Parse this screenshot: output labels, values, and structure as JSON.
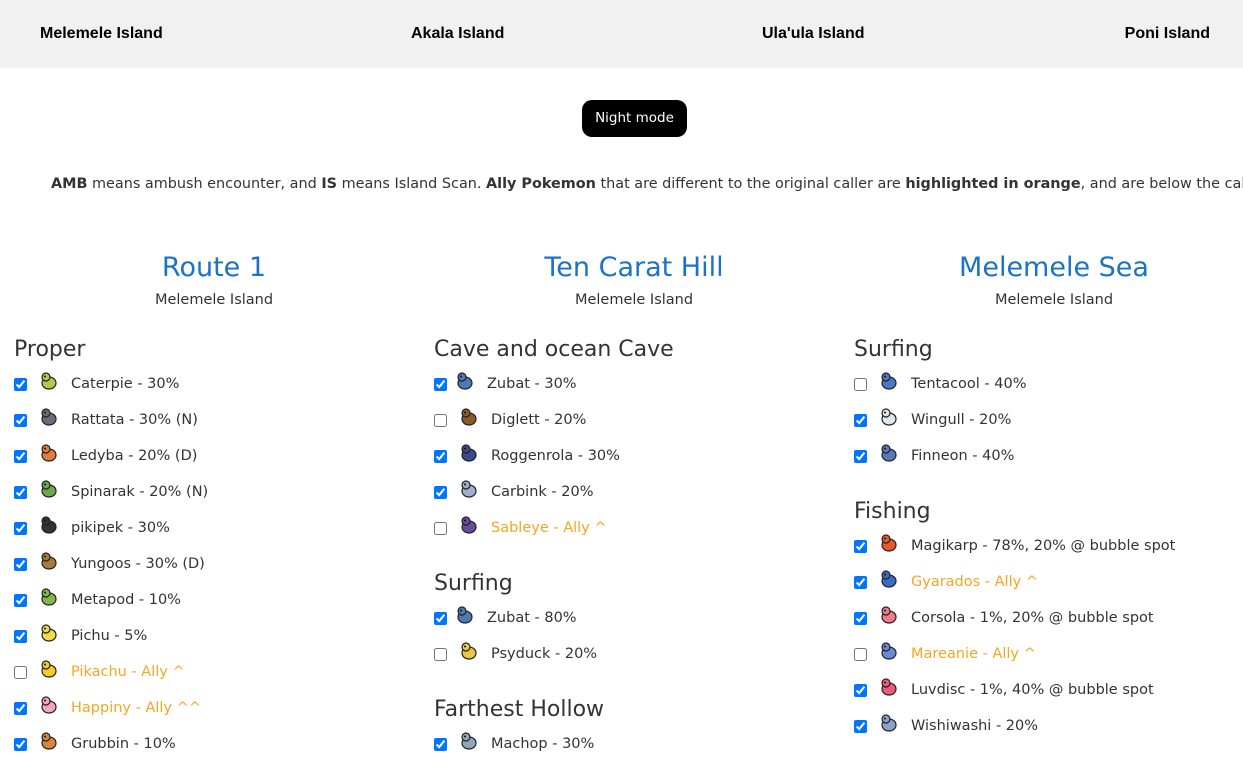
{
  "nav": [
    "Melemele Island",
    "Akala Island",
    "Ula'ula Island",
    "Poni Island"
  ],
  "night_mode_label": "Night mode",
  "info": {
    "amb": "AMB",
    "t1": " means ambush encounter, and ",
    "is": "IS",
    "t2": " means Island Scan. ",
    "ally": "Ally Pokemon",
    "t3": " that are different to the original caller are ",
    "hl": "highlighted in orange",
    "t4": ", and are below the caller."
  },
  "columns": [
    {
      "title": "Route 1",
      "island": "Melemele Island",
      "sections": [
        {
          "title": "Proper",
          "rows": [
            {
              "label": "Caterpie - 30%",
              "checked": true,
              "ally": false,
              "icon": "caterpie-icon",
              "color": "#b5c84a"
            },
            {
              "label": "Rattata - 30% (N)",
              "checked": true,
              "ally": false,
              "icon": "rattata-icon",
              "color": "#6b6b7a"
            },
            {
              "label": "Ledyba - 20% (D)",
              "checked": true,
              "ally": false,
              "icon": "ledyba-icon",
              "color": "#e0803a"
            },
            {
              "label": "Spinarak - 20% (N)",
              "checked": true,
              "ally": false,
              "icon": "spinarak-icon",
              "color": "#6aa84f"
            },
            {
              "label": "pikipek - 30%",
              "checked": true,
              "ally": false,
              "icon": "pikipek-icon",
              "color": "#333333"
            },
            {
              "label": "Yungoos - 30% (D)",
              "checked": true,
              "ally": false,
              "icon": "yungoos-icon",
              "color": "#a97a3c"
            },
            {
              "label": "Metapod - 10%",
              "checked": true,
              "ally": false,
              "icon": "metapod-icon",
              "color": "#7fb94a"
            },
            {
              "label": "Pichu - 5%",
              "checked": true,
              "ally": false,
              "icon": "pichu-icon",
              "color": "#f2d84c"
            },
            {
              "label": "Pikachu - Ally ^",
              "checked": false,
              "ally": true,
              "icon": "pikachu-icon",
              "color": "#f5cc2a"
            },
            {
              "label": "Happiny - Ally ^^",
              "checked": true,
              "ally": true,
              "icon": "happiny-icon",
              "color": "#f4a6b8"
            },
            {
              "label": "Grubbin - 10%",
              "checked": true,
              "ally": false,
              "icon": "grubbin-icon",
              "color": "#d9863a"
            }
          ]
        }
      ]
    },
    {
      "title": "Ten Carat Hill",
      "island": "Melemele Island",
      "sections": [
        {
          "title": "Cave and ocean Cave",
          "rows": [
            {
              "label": "Zubat - 30%",
              "checked": true,
              "ally": false,
              "icon": "zubat-icon",
              "color": "#4a7bb5",
              "tight": true
            },
            {
              "label": "Diglett - 20%",
              "checked": false,
              "ally": false,
              "icon": "diglett-icon",
              "color": "#8b5a2b"
            },
            {
              "label": "Roggenrola - 30%",
              "checked": true,
              "ally": false,
              "icon": "roggenrola-icon",
              "color": "#3b4a8a"
            },
            {
              "label": "Carbink - 20%",
              "checked": true,
              "ally": false,
              "icon": "carbink-icon",
              "color": "#9fb0c8"
            },
            {
              "label": "Sableye - Ally ^",
              "checked": false,
              "ally": true,
              "icon": "sableye-icon",
              "color": "#6a4a9a"
            }
          ]
        },
        {
          "title": "Surfing",
          "rows": [
            {
              "label": "Zubat - 80%",
              "checked": true,
              "ally": false,
              "icon": "zubat-icon",
              "color": "#4a7bb5",
              "tight": true
            },
            {
              "label": "Psyduck - 20%",
              "checked": false,
              "ally": false,
              "icon": "psyduck-icon",
              "color": "#e8c840"
            }
          ]
        },
        {
          "title": "Farthest Hollow",
          "rows": [
            {
              "label": "Machop - 30%",
              "checked": true,
              "ally": false,
              "icon": "machop-icon",
              "color": "#8fa8b8"
            }
          ]
        }
      ]
    },
    {
      "title": "Melemele Sea",
      "island": "Melemele Island",
      "sections": [
        {
          "title": "Surfing",
          "rows": [
            {
              "label": "Tentacool - 40%",
              "checked": false,
              "ally": false,
              "icon": "tentacool-icon",
              "color": "#4a78c8"
            },
            {
              "label": "Wingull - 20%",
              "checked": true,
              "ally": false,
              "icon": "wingull-icon",
              "color": "#dfe6ee"
            },
            {
              "label": "Finneon - 40%",
              "checked": true,
              "ally": false,
              "icon": "finneon-icon",
              "color": "#5a7ab8"
            }
          ]
        },
        {
          "title": "Fishing",
          "rows": [
            {
              "label": "Magikarp - 78%, 20% @ bubble spot",
              "checked": true,
              "ally": false,
              "icon": "magikarp-icon",
              "color": "#e85a2a"
            },
            {
              "label": "Gyarados - Ally ^",
              "checked": true,
              "ally": true,
              "icon": "gyarados-icon",
              "color": "#3a6ac8"
            },
            {
              "label": "Corsola - 1%, 20% @ bubble spot",
              "checked": true,
              "ally": false,
              "icon": "corsola-icon",
              "color": "#f07a8a"
            },
            {
              "label": "Mareanie - Ally ^",
              "checked": false,
              "ally": true,
              "icon": "mareanie-icon",
              "color": "#6a8ad8"
            },
            {
              "label": "Luvdisc - 1%, 40% @ bubble spot",
              "checked": true,
              "ally": false,
              "icon": "luvdisc-icon",
              "color": "#f05a7a"
            },
            {
              "label": "Wishiwashi - 20%",
              "checked": true,
              "ally": false,
              "icon": "wishiwashi-icon",
              "color": "#8aa4c8"
            }
          ]
        }
      ]
    }
  ]
}
